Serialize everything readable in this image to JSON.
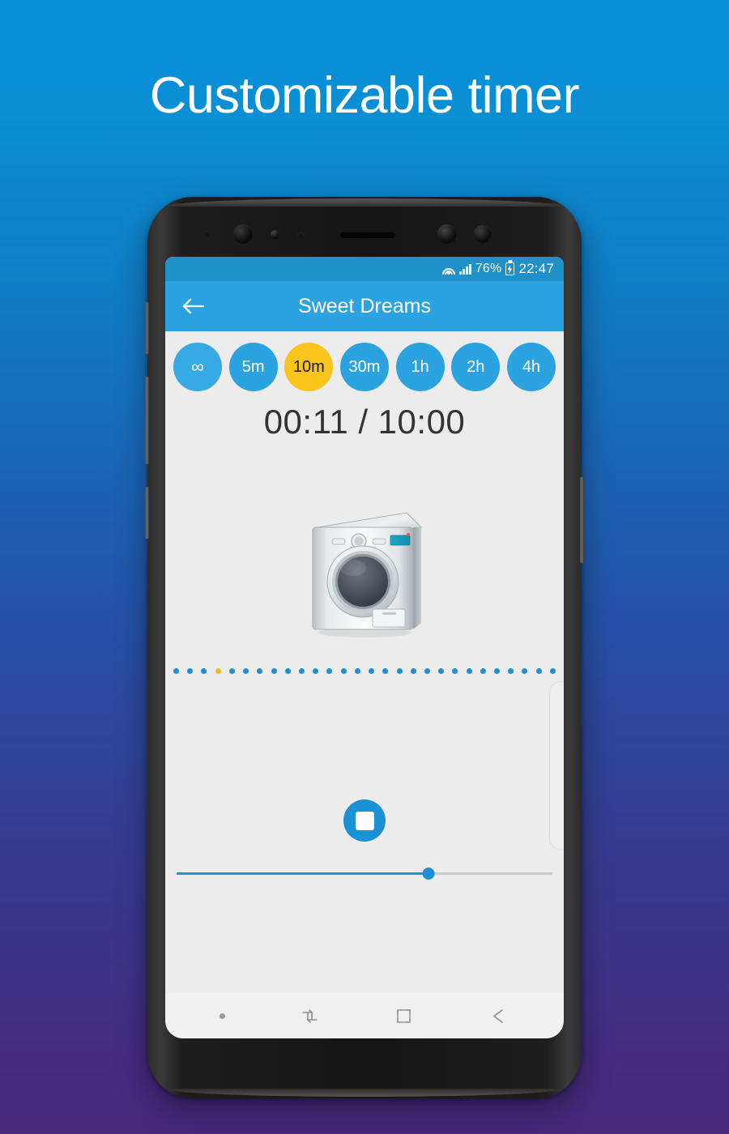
{
  "headline": "Customizable timer",
  "colors": {
    "bg_top": "#0591d8",
    "bg_bottom": "#452a7c",
    "accent_blue": "#2aa3e0",
    "accent_amber": "#f9c51d",
    "screen_bg": "#ececec",
    "statusbar_blue": "#1f90c8"
  },
  "phone": {
    "statusbar": {
      "wifi_icon": "wifi-icon",
      "signal_icon": "cellular-signal-icon",
      "battery_percent": "76%",
      "battery_icon": "battery-charging-icon",
      "time": "22:47"
    },
    "appbar": {
      "back_icon": "back-arrow-icon",
      "title": "Sweet Dreams"
    },
    "timer_chips": [
      {
        "label": "∞",
        "selected": false,
        "name": "chip-infinite"
      },
      {
        "label": "5m",
        "selected": false,
        "name": "chip-5m"
      },
      {
        "label": "10m",
        "selected": true,
        "name": "chip-10m"
      },
      {
        "label": "30m",
        "selected": false,
        "name": "chip-30m"
      },
      {
        "label": "1h",
        "selected": false,
        "name": "chip-1h"
      },
      {
        "label": "2h",
        "selected": false,
        "name": "chip-2h"
      },
      {
        "label": "4h",
        "selected": false,
        "name": "chip-4h"
      }
    ],
    "timer_readout": {
      "elapsed": "00:11",
      "total": "10:00",
      "text": "00:11 / 10:00"
    },
    "sound_icon": "washing-machine-icon",
    "progress_dots": {
      "count": 28,
      "active_index": 3,
      "dot_color": "#1e8fd5",
      "active_color": "#f5b91c"
    },
    "playback": {
      "stop_icon": "stop-square-icon"
    },
    "volume_slider": {
      "value_percent": 67,
      "fill_color": "#1b92d4",
      "track_color": "#c9c9c9"
    },
    "navbar": {
      "indicator_dot": "nav-indicator-dot",
      "recents_icon": "recents-icon",
      "home_icon": "home-square-icon",
      "back_icon": "nav-back-icon"
    }
  }
}
